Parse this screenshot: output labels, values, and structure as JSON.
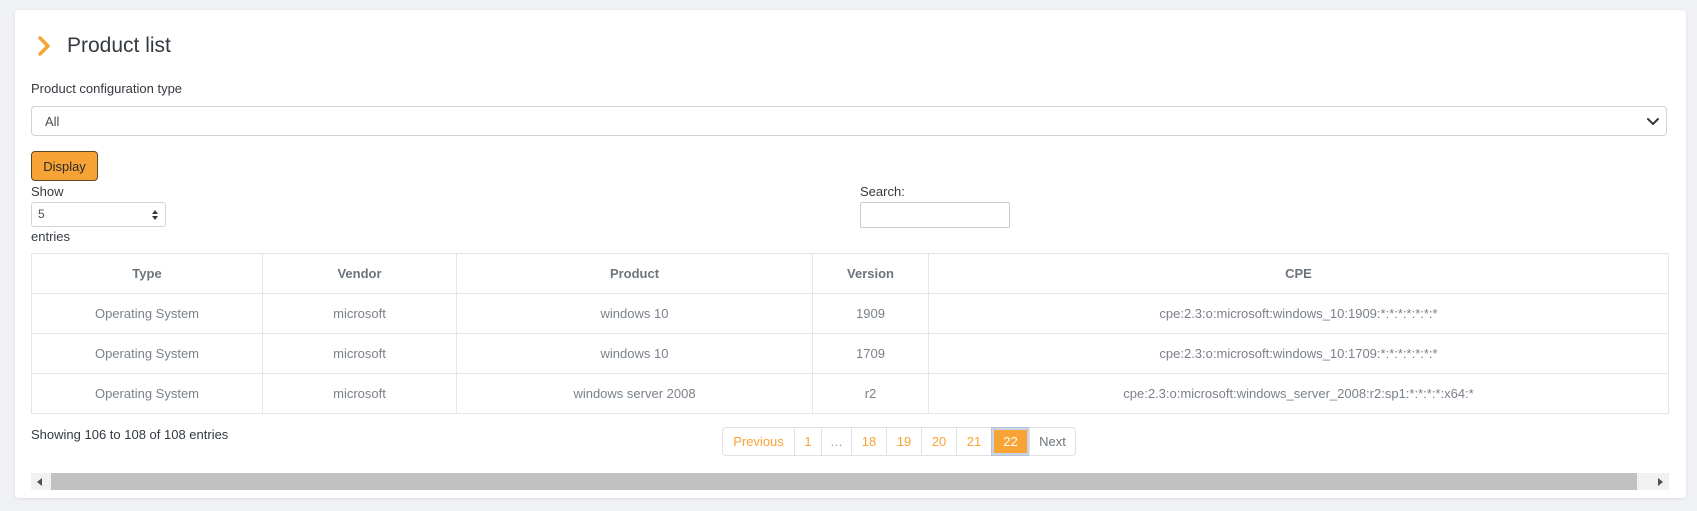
{
  "card": {
    "title": "Product list",
    "chevron_icon": "chevron-right-icon",
    "accent": "#f7a335"
  },
  "filter": {
    "label": "Product configuration type",
    "selected": "All",
    "display_label": "Display"
  },
  "length": {
    "show": "Show",
    "selected": "5",
    "entries": "entries"
  },
  "search": {
    "label": "Search:",
    "value": ""
  },
  "table": {
    "columns": [
      "Type",
      "Vendor",
      "Product",
      "Version",
      "CPE"
    ],
    "rows": [
      [
        "Operating System",
        "microsoft",
        "windows 10",
        "1909",
        "cpe:2.3:o:microsoft:windows_10:1909:*:*:*:*:*:*:*"
      ],
      [
        "Operating System",
        "microsoft",
        "windows 10",
        "1709",
        "cpe:2.3:o:microsoft:windows_10:1709:*:*:*:*:*:*:*"
      ],
      [
        "Operating System",
        "microsoft",
        "windows server 2008",
        "r2",
        "cpe:2.3:o:microsoft:windows_server_2008:r2:sp1:*:*:*:*:x64:*"
      ]
    ]
  },
  "info": "Showing 106 to 108 of 108 entries",
  "pagination": {
    "previous": "Previous",
    "pages": [
      "1",
      "…",
      "18",
      "19",
      "20",
      "21",
      "22"
    ],
    "active": "22",
    "next": "Next"
  }
}
